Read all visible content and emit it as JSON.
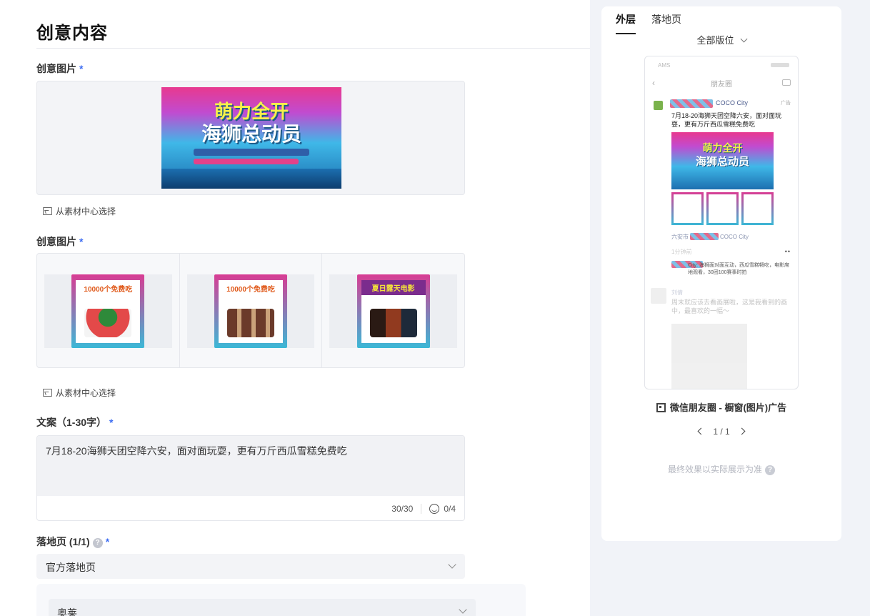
{
  "left": {
    "title": "创意内容",
    "image1": {
      "label": "创意图片",
      "required_mark": "*",
      "banner_line1": "萌力全开",
      "banner_line2": "海狮总动员"
    },
    "pick_from_library": "从素材中心选择",
    "image2": {
      "label": "创意图片",
      "required_mark": "*",
      "cards": [
        {
          "head": "10000个免费吃",
          "art": "watermelon"
        },
        {
          "head": "10000个免费吃",
          "art": "ice-bars"
        },
        {
          "head": "夏日露天电影",
          "art": "movie"
        }
      ]
    },
    "copy": {
      "label": "文案（1-30字）",
      "required_mark": "*",
      "value": "7月18-20海狮天团空降六安，面对面玩耍，更有万斤西瓜雪糕免费吃",
      "char_count": "30/30",
      "emoji_count": "0/4"
    },
    "landing": {
      "label": "落地页 (1/1)",
      "required_mark": "*",
      "help_glyph": "?",
      "type_value": "官方落地页",
      "page_value": "奥莱"
    }
  },
  "right": {
    "tabs": [
      {
        "label": "外层",
        "active": true
      },
      {
        "label": "落地页",
        "active": false
      }
    ],
    "position_select": "全部版位",
    "phone": {
      "status": "AMS",
      "nav_title": "朋友圈",
      "name_suffix": "COCO City",
      "ad_tag": "广告",
      "post_text": "7月18-20海狮天团空降六安，面对面玩耍，更有万斤西瓜雪糕免费吃",
      "mini_banner_1": "萌力全开",
      "mini_banner_2": "海狮总动员",
      "location": "六安市",
      "location_suffix": "COCO City",
      "time": "1分钟前",
      "comment": "City: 海狮面对面互动，西瓜雪糕畅吃，电影席地观看，30团100赛事时拍",
      "next_name": "刘倩",
      "next_text": "周末就应该去看画展啦，这是我看到的画中，最喜欢的一幅～"
    },
    "caption": "微信朋友圈 - 橱窗(图片)广告",
    "pager": "1 / 1",
    "note": "最终效果以实际展示为准",
    "note_help": "?"
  }
}
